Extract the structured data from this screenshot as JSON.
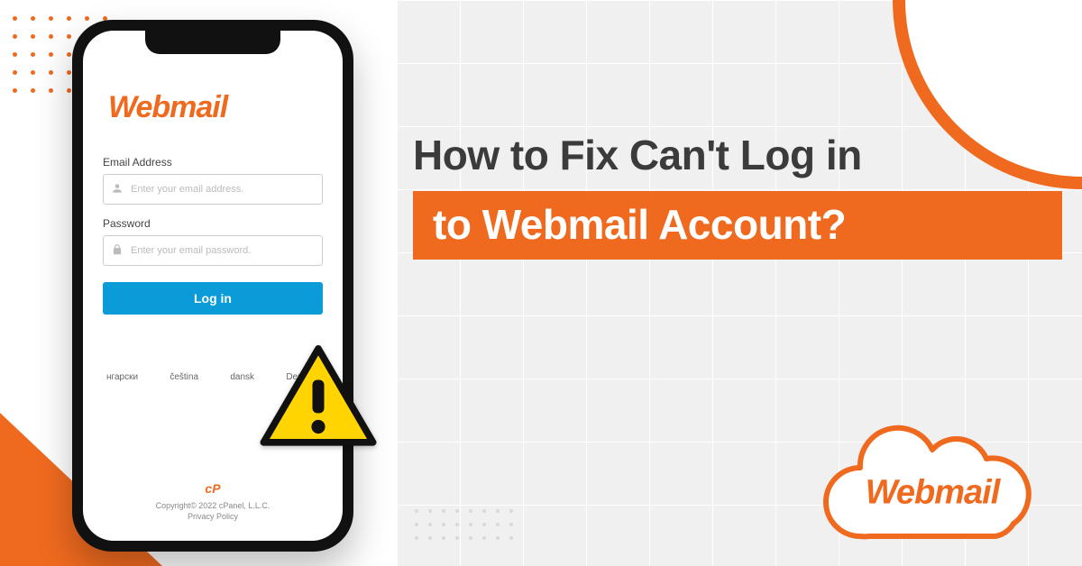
{
  "colors": {
    "accent": "#ef6a1f",
    "button": "#0a9bd8",
    "text": "#3b3b3b"
  },
  "brand": "Webmail",
  "headline": {
    "line1": "How to Fix Can't Log in",
    "line2": "to Webmail Account?"
  },
  "login": {
    "email_label": "Email Address",
    "email_placeholder": "Enter your email address.",
    "password_label": "Password",
    "password_placeholder": "Enter your email password.",
    "button": "Log in"
  },
  "languages": [
    "нгарски",
    "čeština",
    "dansk",
    "Deutsch"
  ],
  "footer": {
    "logo": "cP",
    "copyright": "Copyright© 2022 cPanel, L.L.C.",
    "privacy": "Privacy Policy"
  },
  "icons": {
    "warning": "warning-icon",
    "user": "user-icon",
    "lock": "lock-icon"
  }
}
